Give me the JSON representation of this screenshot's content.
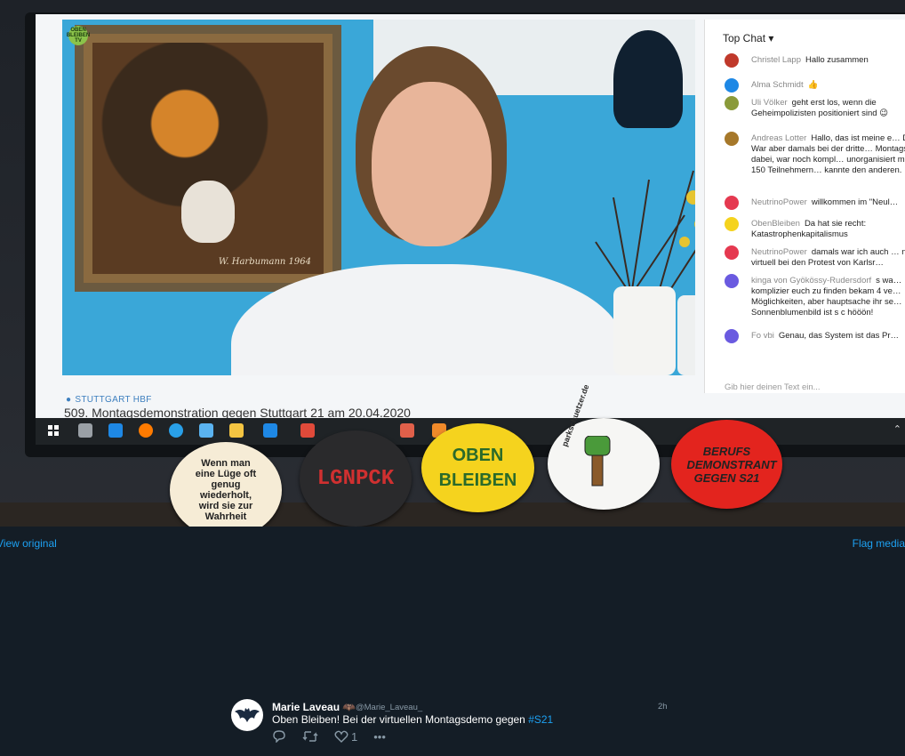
{
  "photo": {
    "logo_text": "OBEN BLEIBEN TV",
    "painting_signature": "W. Harbumann 1964",
    "location": "STUTTGART HBF",
    "stream_title": "509. Montagsdemonstration gegen Stuttgart 21 am 20.04.2020",
    "chat": {
      "header": "Top Chat",
      "messages": [
        {
          "author": "Christel Lapp",
          "text": "Hallo zusammen",
          "color": "#c0392b"
        },
        {
          "author": "Alma Schmidt",
          "text": "👍",
          "color": "#1e88e5"
        },
        {
          "author": "Uli Völker",
          "text": "geht erst los, wenn die Geheimpolizisten positioniert sind 😉",
          "color": "#8a9a3a"
        },
        {
          "author": "Andreas Lotter",
          "text": "Hallo, das ist meine e… Demo. War aber damals bei der dritte… Montagsdemo dabei, war noch kompl… unorganisiert mit ca. 150 Teilnehmern… kannte den anderen.",
          "color": "#a6782a"
        },
        {
          "author": "NeutrinoPower",
          "text": "willkommen im \"Neul…",
          "color": "#e53950"
        },
        {
          "author": "ObenBleiben",
          "text": "Da hat sie recht: Katastrophenkapitalismus",
          "color": "#f5d31e"
        },
        {
          "author": "NeutrinoPower",
          "text": "damals war ich auch … nur virtuell bei den Protest von Karlsr…",
          "color": "#e53950"
        },
        {
          "author": "kinga von Gyökössy-Rudersdorf",
          "text": "s wa… komplizier euch zu finden bekam 4 ve… Möglichkeiten, aber hauptsache ihr se… Sonnenblumenbild ist s c hööön!",
          "color": "#6a5ae0"
        },
        {
          "author": "Fo vbi",
          "text": "Genau, das System ist das Pr…",
          "color": "#6a5ae0"
        }
      ],
      "input_placeholder": "Gib hier deinen Text ein..."
    },
    "badges": [
      {
        "text": "Wenn man eine Lüge oft genug wiederholt, wird sie zur Wahrheit"
      },
      {
        "text": "LGNPCK"
      },
      {
        "text": "OBEN BLEIBEN"
      },
      {
        "text": "parkschuetzer.de"
      },
      {
        "text": "BERUFS DEMONSTRANT GEGEN S21"
      }
    ]
  },
  "links": {
    "view_original": "View original",
    "flag_media": "Flag media"
  },
  "tweet": {
    "author_name": "Marie Laveau 🦇",
    "handle": "@Marie_Laveau_",
    "time": "2h",
    "text_prefix": "Oben Bleiben! Bei der virtuellen Montagsdemo gegen ",
    "hashtag": "#S21",
    "like_count": "1"
  }
}
